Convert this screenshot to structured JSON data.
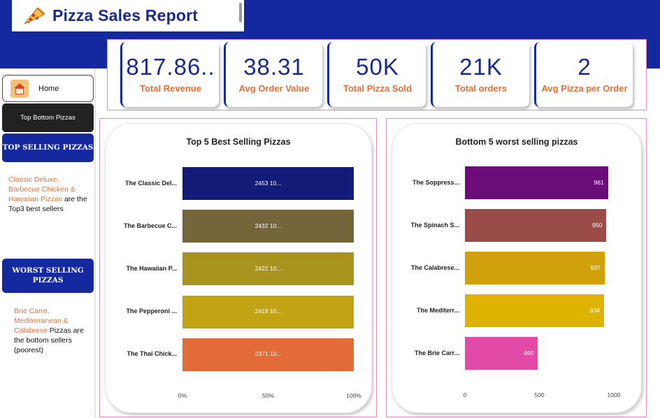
{
  "header": {
    "title": "Pizza Sales Report",
    "brand_color": "#1428a0",
    "icon": "pizza-icon"
  },
  "kpis": [
    {
      "value": "817.86..",
      "label": "Total Revenue"
    },
    {
      "value": "38.31",
      "label": "Avg Order Value"
    },
    {
      "value": "50K",
      "label": "Total Pizza Sold"
    },
    {
      "value": "21K",
      "label": "Total orders"
    },
    {
      "value": "2",
      "label": "Avg Pizza per Order"
    }
  ],
  "sidebar": {
    "home_label": "Home",
    "home_icon": "home-icon",
    "top_bottom_label": "Top Bottom Pizzas",
    "top_selling_heading": "TOP SELLING PIZZAS",
    "top_note": {
      "highlight": "Classic Deluxe, Barbecue Chicken & Hawaiian Pizzas",
      "rest": "are the Top3 best sellers"
    },
    "worst_selling_heading": "WORST SELLING PIZZAS",
    "worst_note": {
      "highlight": "Brie Carre, Mediterranean & Calabrese",
      "rest": "Pizzas are the bottom sellers (poorest)"
    }
  },
  "chart_data": [
    {
      "type": "bar",
      "orientation": "horizontal",
      "title": "Top 5 Best Selling Pizzas",
      "categories": [
        "The Classic Del...",
        "The Barbecue C...",
        "The Hawaiian P...",
        "The Pepperoni ...",
        "The Thai Chick..."
      ],
      "values": [
        100,
        100,
        100,
        100,
        100
      ],
      "data_labels": [
        "2453 10...",
        "2432 10...",
        "2422 10...",
        "2418 10...",
        "2371 10..."
      ],
      "colors": [
        "#121b78",
        "#75653a",
        "#a8931e",
        "#c2a314",
        "#e26b38"
      ],
      "x_ticks": [
        "0%",
        "50%",
        "100%"
      ],
      "xlim": [
        0,
        100
      ]
    },
    {
      "type": "bar",
      "orientation": "horizontal",
      "title": "Bottom 5 worst selling pizzas",
      "categories": [
        "The Soppress...",
        "The Spinach S...",
        "The Calabrese...",
        "The Mediterr...",
        "The Brie Carr..."
      ],
      "values": [
        961,
        950,
        937,
        934,
        490
      ],
      "data_labels": [
        "961",
        "950",
        "937",
        "934",
        "490"
      ],
      "colors": [
        "#6c0c7a",
        "#9a4d48",
        "#d0a10a",
        "#ddb300",
        "#e24aa8"
      ],
      "x_ticks": [
        "0",
        "500",
        "1000"
      ],
      "xlim": [
        0,
        1000
      ]
    }
  ]
}
